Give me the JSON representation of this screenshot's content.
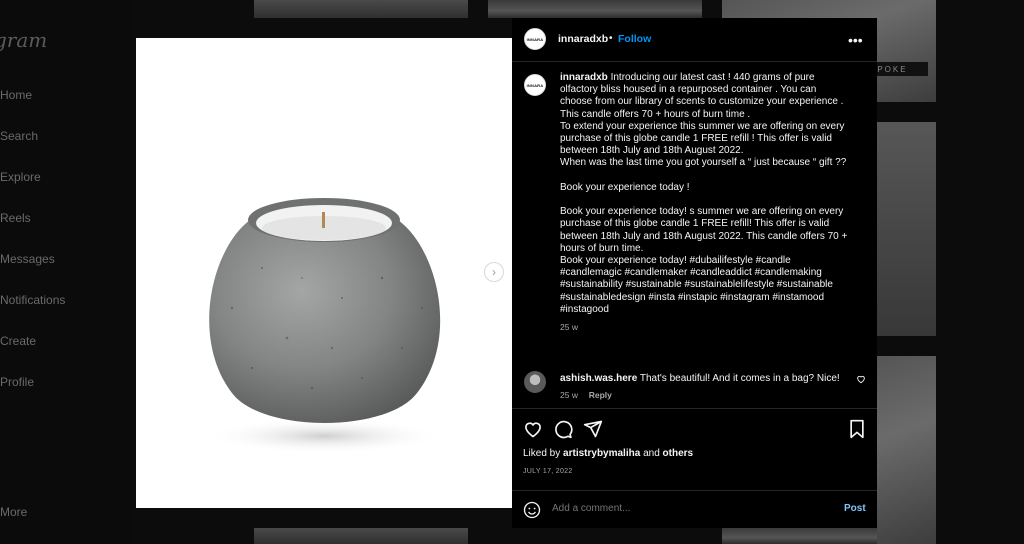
{
  "sidebar": {
    "logo": "gram",
    "items": [
      "Home",
      "Search",
      "Explore",
      "Reels",
      "Messages",
      "Notifications",
      "Create",
      "Profile"
    ],
    "more": "More"
  },
  "background": {
    "tile_label": "SPOKE"
  },
  "post": {
    "username": "innaradxb",
    "avatar_text": "INNARA",
    "separator": "•",
    "follow_label": "Follow",
    "more_icon": "more-horizontal-icon",
    "next_icon": "chevron-right-icon",
    "caption_lines": [
      "Introducing our latest cast ! 440 grams of pure",
      "olfactory bliss housed in a repurposed container . You can",
      "choose from our library of scents to customize your experience .",
      "This candle offers 70 + hours of burn time .",
      "To extend your experience this summer we are offering on every",
      "purchase of this globe candle 1 FREE refill ! This offer is valid",
      "between 18th July and 18th August 2022.",
      "When was the last time you got yourself a “ just because “ gift ??",
      "",
      "Book your experience today !",
      "",
      "Book your experience today! s summer we are offering on every",
      "purchase of this globe candle 1 FREE refill! This offer is valid",
      "between 18th July and 18th August 2022. This candle offers 70 +",
      "hours of burn time.",
      "Book your experience today! #dubailifestyle #candle",
      "#candlemagic #candlemaker #candleaddict #candlemaking",
      "#sustainability #sustainable #sustainablelifestyle #sustainable",
      "#sustainabledesign #insta #instapic #instagram #instamood",
      "#instagood"
    ],
    "caption_time": "25 w",
    "comment": {
      "username": "ashish.was.here",
      "text": "That's beautiful! And it comes in a bag? Nice!",
      "time": "25 w",
      "reply_label": "Reply"
    },
    "likes_prefix": "Liked by",
    "liked_by": "artistrybymaliha",
    "likes_and": "and",
    "likes_others": "others",
    "date": "JULY 17, 2022",
    "add_comment_placeholder": "Add a comment...",
    "post_label": "Post"
  },
  "colors": {
    "accent": "#0095f6",
    "post_button": "#7fc6fb",
    "panel_bg": "#000000"
  }
}
